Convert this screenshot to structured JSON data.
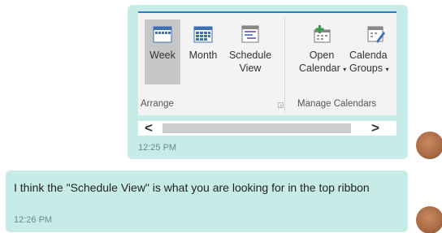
{
  "ribbon": {
    "buttons": {
      "week": "Week",
      "month": "Month",
      "schedule_line1": "Schedule",
      "schedule_line2": "View",
      "open_line1": "Open",
      "open_line2": "Calendar",
      "groups_line1": "Calenda",
      "groups_line2": "Groups"
    },
    "groups": {
      "arrange": "Arrange",
      "manage": "Manage Calendars"
    },
    "icons": [
      "week-icon",
      "month-icon",
      "schedule-view-icon",
      "open-calendar-icon",
      "calendar-groups-icon"
    ],
    "accent_color": "#2c7cc7"
  },
  "messages": [
    {
      "text": "",
      "time": "12:25 PM"
    },
    {
      "text": "I think the \"Schedule View\" is what you are looking for in the top ribbon",
      "time": "12:26 PM"
    }
  ],
  "colors": {
    "bubble": "#c7ece8",
    "selected_button": "#c6c6c6"
  }
}
